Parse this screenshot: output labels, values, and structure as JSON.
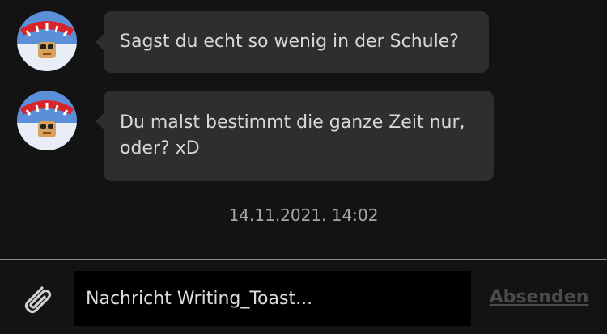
{
  "messages": [
    {
      "avatar_icon": "user-avatar-icon",
      "lines": [
        "Sagst du echt so wenig in der Schule?"
      ]
    },
    {
      "avatar_icon": "user-avatar-icon",
      "lines": [
        "Du malst bestimmt die ganze Zeit nur,",
        "oder? xD"
      ]
    }
  ],
  "timestamp": "14.11.2021. 14:02",
  "composer": {
    "attach_icon": "paperclip-icon",
    "placeholder": "Nachricht Writing_Toast...",
    "value": "",
    "send_label": "Absenden"
  },
  "colors": {
    "background": "#131313",
    "bubble": "#2e2e2e",
    "bubble_text": "#d8d8d8",
    "input_background": "#000000",
    "send_disabled": "#4b4b4b"
  }
}
